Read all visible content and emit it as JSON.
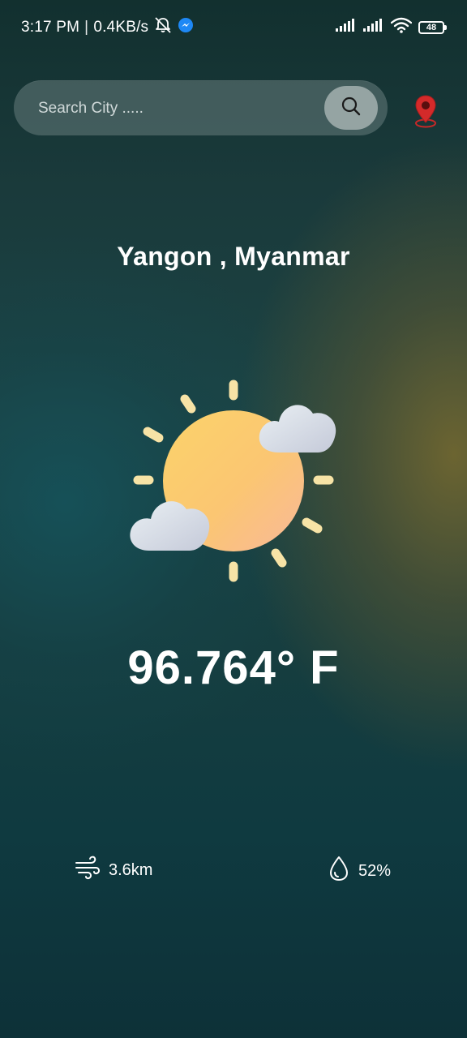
{
  "status_bar": {
    "time": "3:17 PM",
    "separator": "|",
    "speed": "0.4KB/s",
    "battery": "48",
    "icons": [
      "mute-icon",
      "messenger-icon",
      "signal-icon",
      "signal-icon",
      "wifi-icon",
      "battery-icon"
    ]
  },
  "search": {
    "placeholder": "Search City .....",
    "value": "",
    "button_icon": "search-icon"
  },
  "location_icon": "location-pin-icon",
  "location": {
    "city": "Yangon , Myanmar"
  },
  "weather": {
    "icon": "sun-with-clouds-icon",
    "temperature": "96.764° F"
  },
  "stats": {
    "wind": {
      "icon": "wind-icon",
      "value": "3.6km"
    },
    "humidity": {
      "icon": "droplet-icon",
      "value": "52%"
    }
  },
  "colors": {
    "location_pin": "#d42a2a",
    "sun": "#fbc66a",
    "sun_rays": "#f7e3a6",
    "cloud": "#dfe3ec"
  }
}
